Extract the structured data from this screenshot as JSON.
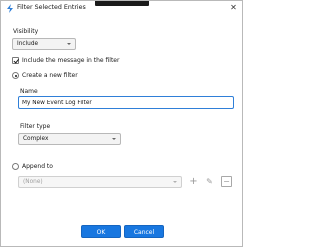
{
  "window": {
    "title": "Filter Selected Entries",
    "close_glyph": "✕"
  },
  "visibility": {
    "label": "Visibility",
    "selected": "Include"
  },
  "include_message": {
    "label": "Include the message in the filter",
    "checked": true
  },
  "create_new": {
    "label": "Create a new filter",
    "selected": true,
    "name_label": "Name",
    "name_value": "My New Event Log Filter",
    "filter_type_label": "Filter type",
    "filter_type_value": "Complex"
  },
  "append_to": {
    "label": "Append to",
    "selected": false,
    "value": "(None)"
  },
  "tools": {
    "add": "+",
    "edit": "✎",
    "remove": "−"
  },
  "buttons": {
    "ok": "OK",
    "cancel": "Cancel"
  },
  "colors": {
    "accent": "#1877e0",
    "focus_border": "#2f7fd8"
  }
}
